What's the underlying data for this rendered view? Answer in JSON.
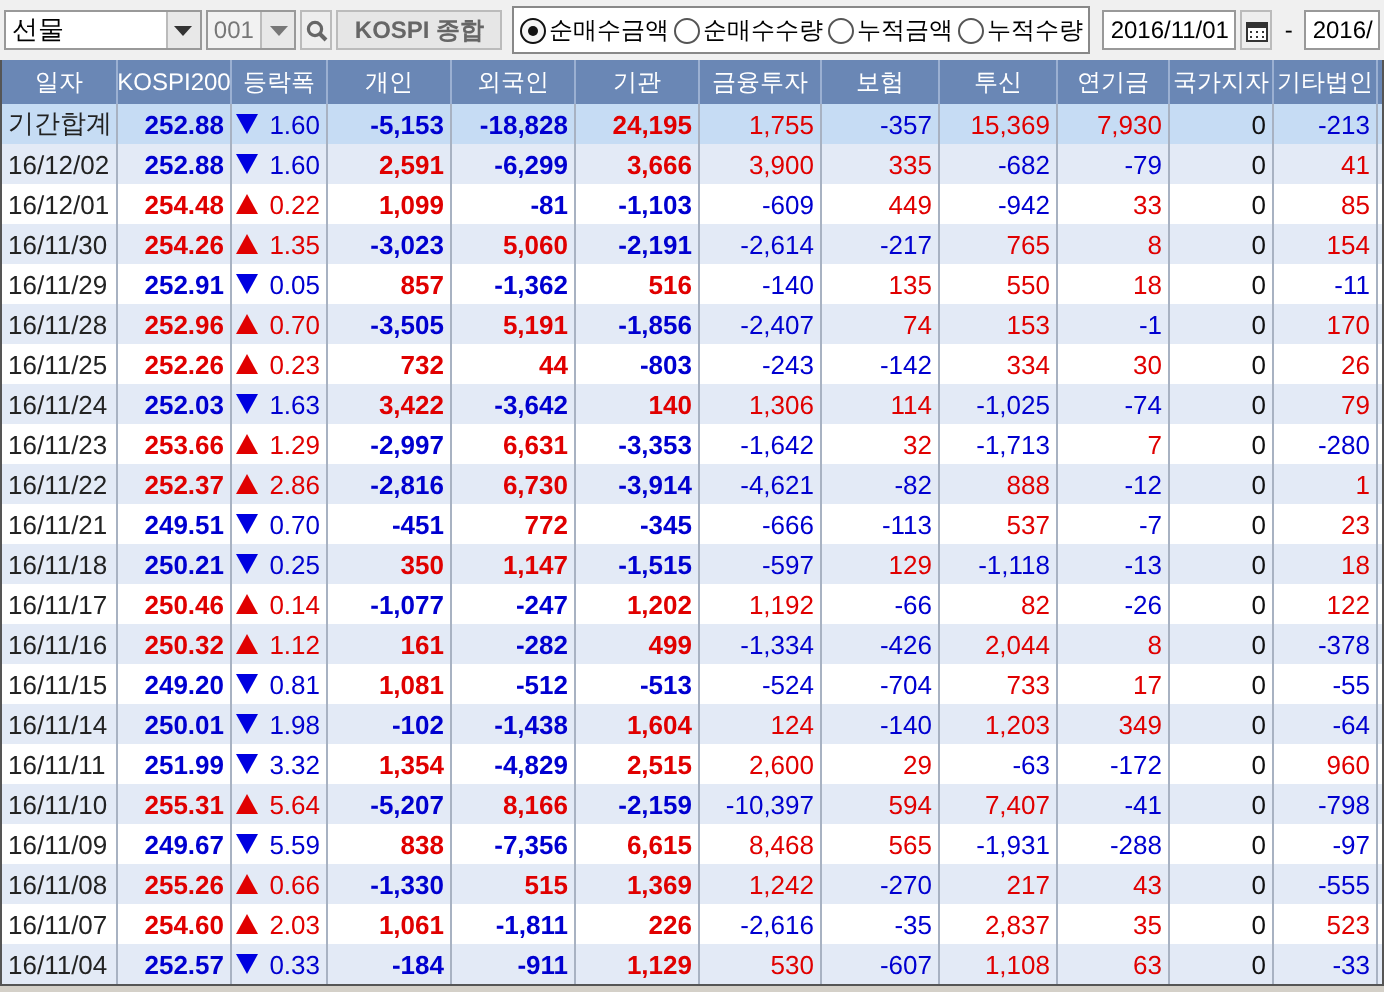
{
  "toolbar": {
    "market_select": {
      "value": "선물"
    },
    "code_field": {
      "value": "001"
    },
    "index_name": "KOSPI 종합",
    "modes": [
      {
        "label": "순매수금액",
        "selected": true
      },
      {
        "label": "순매수수량",
        "selected": false
      },
      {
        "label": "누적금액",
        "selected": false
      },
      {
        "label": "누적수량",
        "selected": false
      }
    ],
    "date_from": "2016/11/01",
    "date_separator": "-",
    "date_to": "2016/"
  },
  "table": {
    "columns": [
      "일자",
      "KOSPI200",
      "등락폭",
      "개인",
      "외국인",
      "기관",
      "금융투자",
      "보험",
      "투신",
      "연기금",
      "국가지자",
      "기타법인"
    ],
    "rows": [
      {
        "kind": "total",
        "up": false,
        "cells": [
          "기간합계",
          "252.88",
          "1.60",
          "-5,153",
          "-18,828",
          "24,195",
          "1,755",
          "-357",
          "15,369",
          "7,930",
          "0",
          "-213"
        ]
      },
      {
        "kind": "day",
        "up": false,
        "cells": [
          "16/12/02",
          "252.88",
          "1.60",
          "2,591",
          "-6,299",
          "3,666",
          "3,900",
          "335",
          "-682",
          "-79",
          "0",
          "41"
        ]
      },
      {
        "kind": "day",
        "up": true,
        "cells": [
          "16/12/01",
          "254.48",
          "0.22",
          "1,099",
          "-81",
          "-1,103",
          "-609",
          "449",
          "-942",
          "33",
          "0",
          "85"
        ]
      },
      {
        "kind": "day",
        "up": true,
        "cells": [
          "16/11/30",
          "254.26",
          "1.35",
          "-3,023",
          "5,060",
          "-2,191",
          "-2,614",
          "-217",
          "765",
          "8",
          "0",
          "154"
        ]
      },
      {
        "kind": "day",
        "up": false,
        "cells": [
          "16/11/29",
          "252.91",
          "0.05",
          "857",
          "-1,362",
          "516",
          "-140",
          "135",
          "550",
          "18",
          "0",
          "-11"
        ]
      },
      {
        "kind": "day",
        "up": true,
        "cells": [
          "16/11/28",
          "252.96",
          "0.70",
          "-3,505",
          "5,191",
          "-1,856",
          "-2,407",
          "74",
          "153",
          "-1",
          "0",
          "170"
        ]
      },
      {
        "kind": "day",
        "up": true,
        "cells": [
          "16/11/25",
          "252.26",
          "0.23",
          "732",
          "44",
          "-803",
          "-243",
          "-142",
          "334",
          "30",
          "0",
          "26"
        ]
      },
      {
        "kind": "day",
        "up": false,
        "cells": [
          "16/11/24",
          "252.03",
          "1.63",
          "3,422",
          "-3,642",
          "140",
          "1,306",
          "114",
          "-1,025",
          "-74",
          "0",
          "79"
        ]
      },
      {
        "kind": "day",
        "up": true,
        "cells": [
          "16/11/23",
          "253.66",
          "1.29",
          "-2,997",
          "6,631",
          "-3,353",
          "-1,642",
          "32",
          "-1,713",
          "7",
          "0",
          "-280"
        ]
      },
      {
        "kind": "day",
        "up": true,
        "cells": [
          "16/11/22",
          "252.37",
          "2.86",
          "-2,816",
          "6,730",
          "-3,914",
          "-4,621",
          "-82",
          "888",
          "-12",
          "0",
          "1"
        ]
      },
      {
        "kind": "day",
        "up": false,
        "cells": [
          "16/11/21",
          "249.51",
          "0.70",
          "-451",
          "772",
          "-345",
          "-666",
          "-113",
          "537",
          "-7",
          "0",
          "23"
        ]
      },
      {
        "kind": "day",
        "up": false,
        "cells": [
          "16/11/18",
          "250.21",
          "0.25",
          "350",
          "1,147",
          "-1,515",
          "-597",
          "129",
          "-1,118",
          "-13",
          "0",
          "18"
        ]
      },
      {
        "kind": "day",
        "up": true,
        "cells": [
          "16/11/17",
          "250.46",
          "0.14",
          "-1,077",
          "-247",
          "1,202",
          "1,192",
          "-66",
          "82",
          "-26",
          "0",
          "122"
        ]
      },
      {
        "kind": "day",
        "up": true,
        "cells": [
          "16/11/16",
          "250.32",
          "1.12",
          "161",
          "-282",
          "499",
          "-1,334",
          "-426",
          "2,044",
          "8",
          "0",
          "-378"
        ]
      },
      {
        "kind": "day",
        "up": false,
        "cells": [
          "16/11/15",
          "249.20",
          "0.81",
          "1,081",
          "-512",
          "-513",
          "-524",
          "-704",
          "733",
          "17",
          "0",
          "-55"
        ]
      },
      {
        "kind": "day",
        "up": false,
        "cells": [
          "16/11/14",
          "250.01",
          "1.98",
          "-102",
          "-1,438",
          "1,604",
          "124",
          "-140",
          "1,203",
          "349",
          "0",
          "-64"
        ]
      },
      {
        "kind": "day",
        "up": false,
        "cells": [
          "16/11/11",
          "251.99",
          "3.32",
          "1,354",
          "-4,829",
          "2,515",
          "2,600",
          "29",
          "-63",
          "-172",
          "0",
          "960"
        ]
      },
      {
        "kind": "day",
        "up": true,
        "cells": [
          "16/11/10",
          "255.31",
          "5.64",
          "-5,207",
          "8,166",
          "-2,159",
          "-10,397",
          "594",
          "7,407",
          "-41",
          "0",
          "-798"
        ]
      },
      {
        "kind": "day",
        "up": false,
        "cells": [
          "16/11/09",
          "249.67",
          "5.59",
          "838",
          "-7,356",
          "6,615",
          "8,468",
          "565",
          "-1,931",
          "-288",
          "0",
          "-97"
        ]
      },
      {
        "kind": "day",
        "up": true,
        "cells": [
          "16/11/08",
          "255.26",
          "0.66",
          "-1,330",
          "515",
          "1,369",
          "1,242",
          "-270",
          "217",
          "43",
          "0",
          "-555"
        ]
      },
      {
        "kind": "day",
        "up": true,
        "cells": [
          "16/11/07",
          "254.60",
          "2.03",
          "1,061",
          "-1,811",
          "226",
          "-2,616",
          "-35",
          "2,837",
          "35",
          "0",
          "523"
        ]
      },
      {
        "kind": "day",
        "up": false,
        "cells": [
          "16/11/04",
          "252.57",
          "0.33",
          "-184",
          "-911",
          "1,129",
          "530",
          "-607",
          "1,108",
          "63",
          "0",
          "-33"
        ]
      }
    ]
  }
}
